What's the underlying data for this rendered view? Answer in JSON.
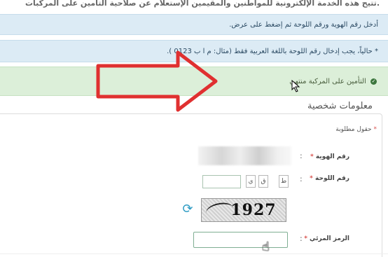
{
  "top_text": "تتيح هذه الخدمة الإلكترونية للمواطنين والمقيمين الإستعلام عن صلاحية التأمين على المركبات.",
  "info_1": "أدخل رقم الهوية ورقم اللوحة ثم إضغط على عرض.",
  "info_2": "* حالياً، يجب إدخال رقم اللوحة باللغة العربية فقط (مثال: م ا ب 0123 ).",
  "success_msg": "التأمين على المركبة منتهي",
  "section_title": "معلومات شخصية",
  "required_note": "حقول مطلوبة",
  "labels": {
    "id_number": "رقم الهوية",
    "plate_number": "رقم اللوحة",
    "visual_code": "الرمز المرئي"
  },
  "plate_letters": [
    "ي",
    "ق",
    "ط"
  ],
  "captcha_text": "1927",
  "colors": {
    "info_bg": "#dcebf5",
    "success_bg": "#dcefd9",
    "arrow": "#e03030",
    "required": "#d9534f"
  },
  "icons": {
    "success": "check-circle-icon",
    "refresh": "refresh-icon",
    "cursor_arrow": "arrow-cursor-icon",
    "cursor_hand": "hand-cursor-icon"
  }
}
